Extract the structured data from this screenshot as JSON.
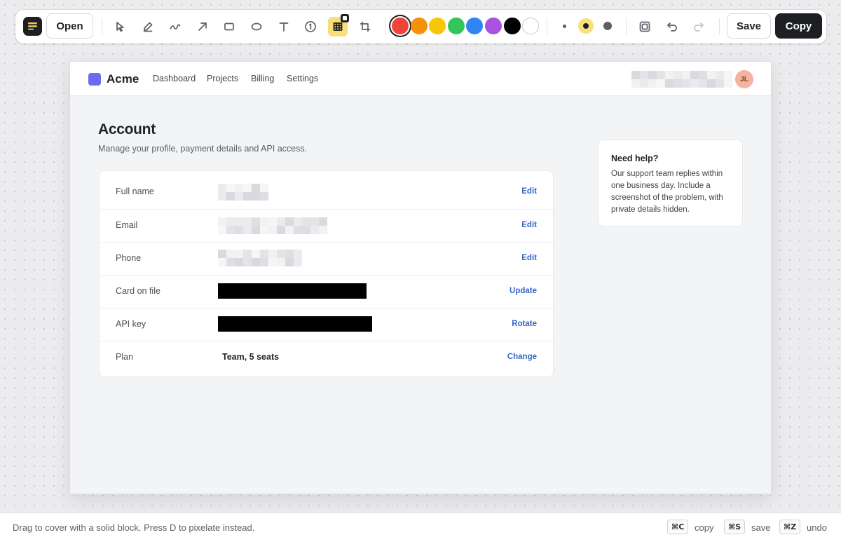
{
  "toolbar": {
    "open_label": "Open",
    "save_label": "Save",
    "copy_label": "Copy",
    "tools": [
      "select-tool",
      "highlighter-tool",
      "freehand-tool",
      "arrow-tool",
      "rectangle-tool",
      "ellipse-tool",
      "text-tool",
      "step-number-tool",
      "pixelate-tool",
      "crop-tool"
    ],
    "active_tool": "pixelate-tool",
    "step_number": "1",
    "colors": [
      "#f0443a",
      "#f5900a",
      "#f7c609",
      "#34c55a",
      "#2f86f2",
      "#a952e0",
      "#000000",
      "#ffffff"
    ],
    "selected_color": "#f0443a",
    "stroke_sizes": [
      "small",
      "medium",
      "large"
    ],
    "selected_stroke": "medium"
  },
  "page": {
    "brand": "Acme",
    "nav": [
      "Dashboard",
      "Projects",
      "Billing",
      "Settings"
    ],
    "avatar_initials": "JL",
    "title": "Account",
    "subtitle": "Manage your profile, payment details and API access.",
    "rows": [
      {
        "label": "Full name",
        "action": "Edit",
        "value_state": "pixelated"
      },
      {
        "label": "Email",
        "action": "Edit",
        "value_state": "pixelated"
      },
      {
        "label": "Phone",
        "action": "Edit",
        "value_state": "pixelated"
      },
      {
        "label": "Card on file",
        "action": "Update",
        "value_state": "redacted"
      },
      {
        "label": "API key",
        "action": "Rotate",
        "value_state": "redacted"
      },
      {
        "label": "Plan",
        "action": "Change",
        "value": "Team, 5 seats"
      }
    ],
    "help": {
      "title": "Need help?",
      "body": "Our support team replies within one business day. Include a screenshot of the problem, with private details hidden."
    }
  },
  "statusbar": {
    "hint": "Drag to cover with a solid block. Press D to pixelate instead.",
    "shortcuts": [
      {
        "keys": "⌘C",
        "label": "copy"
      },
      {
        "keys": "⌘S",
        "label": "save"
      },
      {
        "keys": "⌘Z",
        "label": "undo"
      }
    ]
  }
}
